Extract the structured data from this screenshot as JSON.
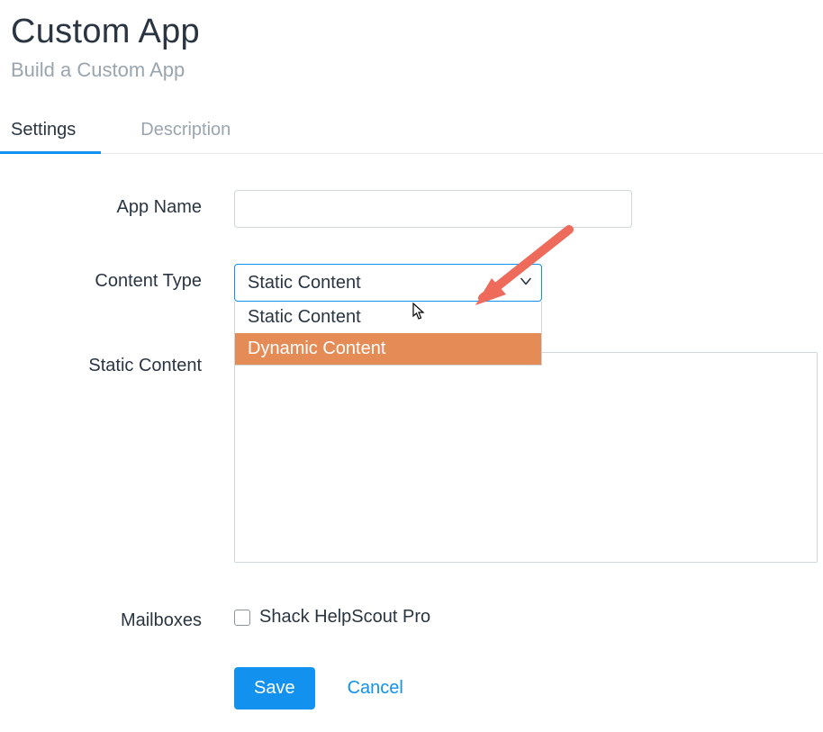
{
  "header": {
    "title": "Custom App",
    "subtitle": "Build a Custom App"
  },
  "tabs": {
    "settings": "Settings",
    "description": "Description"
  },
  "form": {
    "app_name": {
      "label": "App Name",
      "value": ""
    },
    "content_type": {
      "label": "Content Type",
      "selected": "Static Content",
      "options": [
        "Static Content",
        "Dynamic Content"
      ]
    },
    "static_content": {
      "label": "Static Content",
      "value": ""
    },
    "mailboxes": {
      "label": "Mailboxes",
      "items": [
        {
          "label": "Shack HelpScout Pro",
          "checked": false
        }
      ]
    }
  },
  "actions": {
    "save": "Save",
    "cancel": "Cancel"
  },
  "annotations": {
    "arrow_color": "#ee6a5a"
  }
}
